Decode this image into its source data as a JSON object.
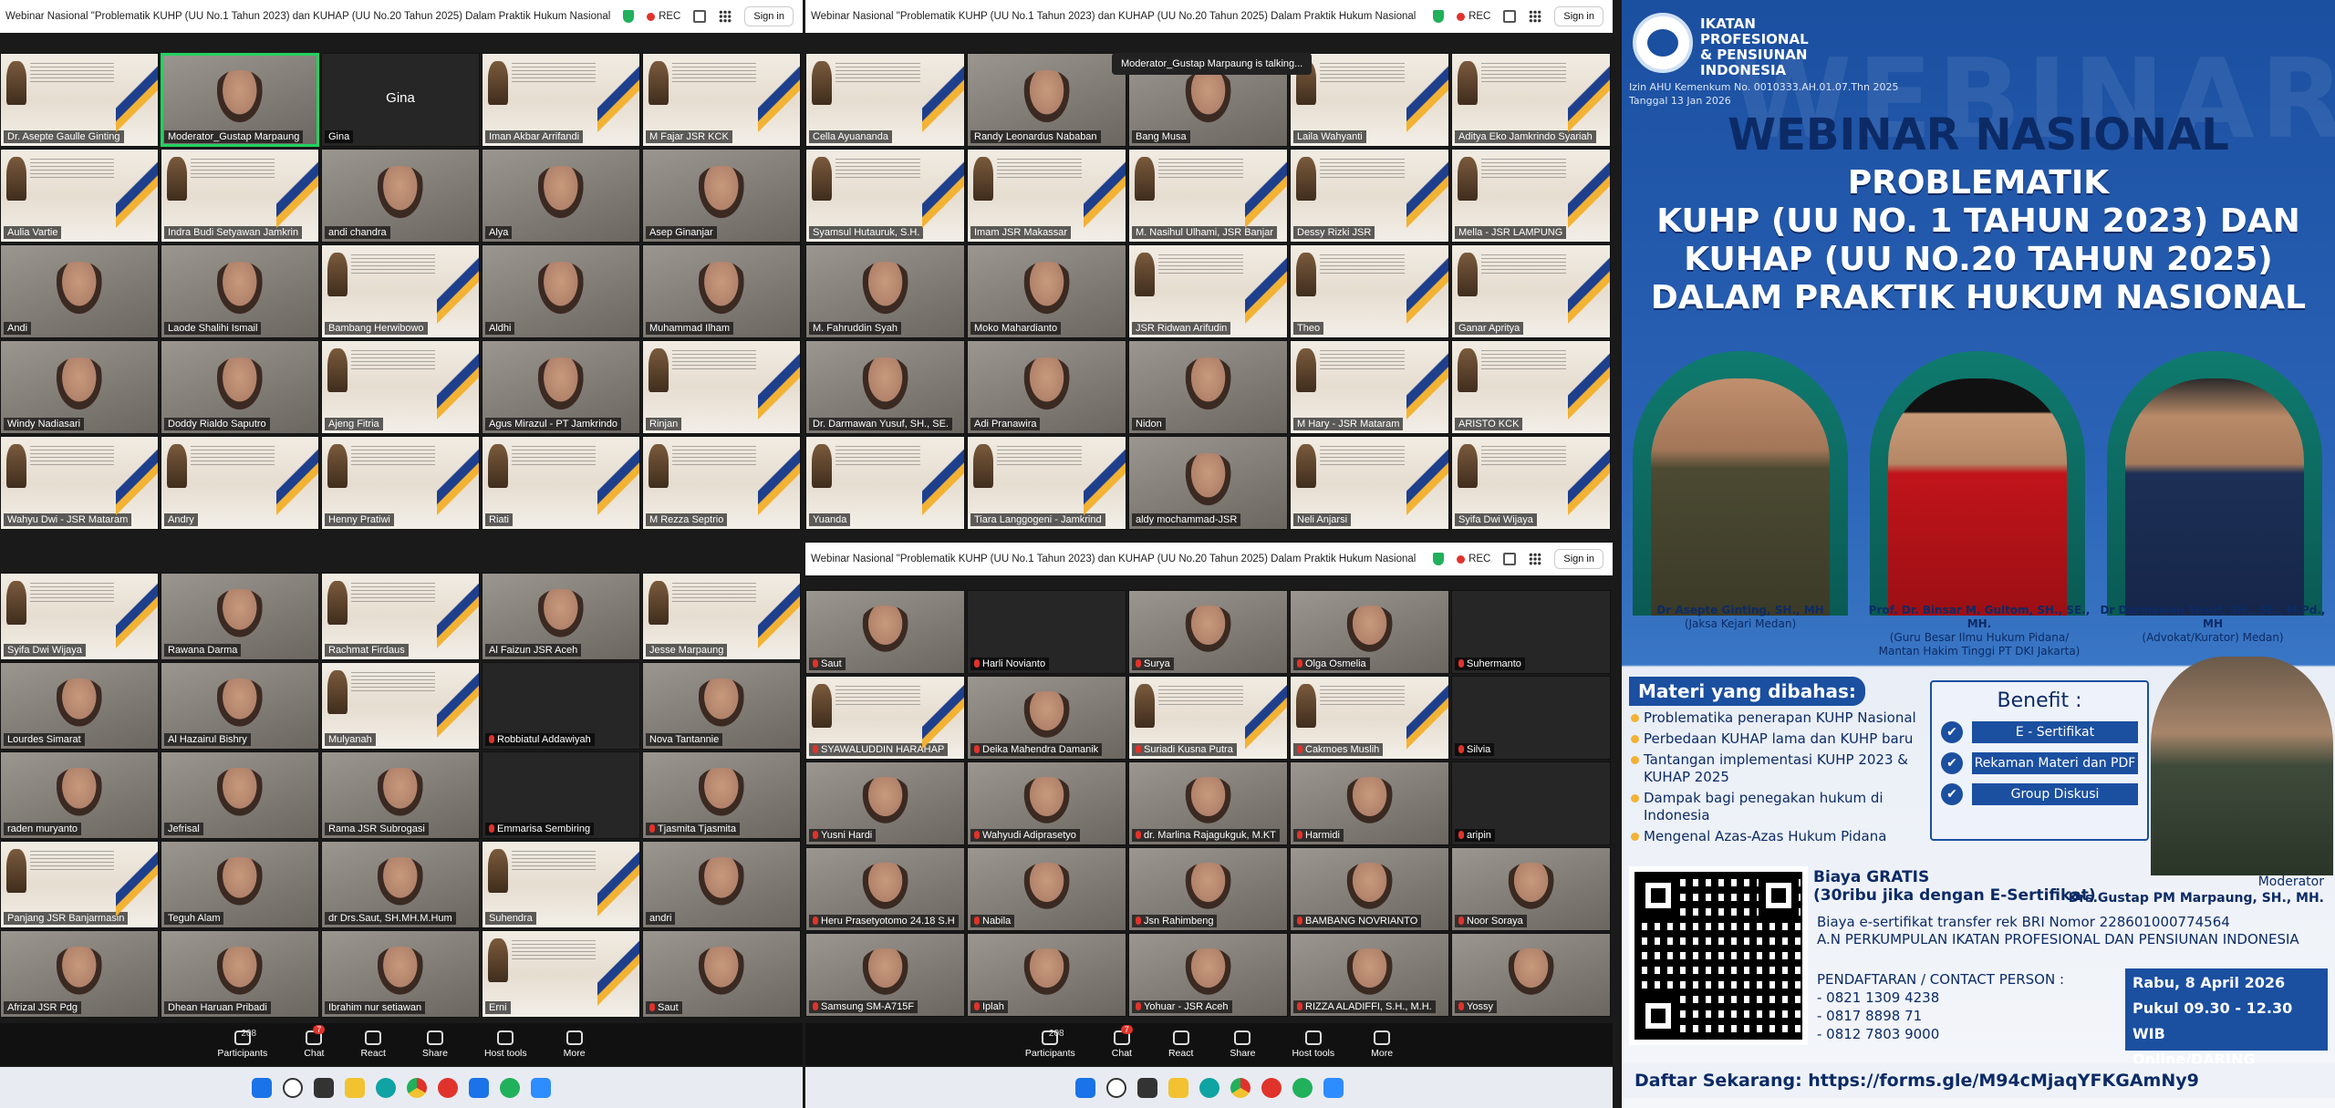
{
  "window_title": "Webinar Nasional \"Problematik KUHP (UU No.1 Tahun 2023) dan KUHAP (UU No.20 Tahun 2025) Dalam Praktik Hukum Nasional",
  "rec_label": "REC",
  "signin_label": "Sign in",
  "talking_tip": "Moderator_Gustap Marpaung is talking...",
  "active_name": "Gina",
  "controls": {
    "participants": "Participants",
    "participants_count": "208",
    "chat": "Chat",
    "chat_badge": "7",
    "react": "React",
    "share": "Share",
    "host_tools": "Host tools",
    "more": "More"
  },
  "win1_names": [
    "Dr. Asepte Gaulle Ginting",
    "Moderator_Gustap Marpaung",
    "Gina",
    "Iman Akbar Arrifandi",
    "M Fajar JSR KCK",
    "Aulia Vartie",
    "Indra Budi Setyawan Jamkrin",
    "andi chandra",
    "Alya",
    "Asep Ginanjar",
    "Andi",
    "Laode Shalihi Ismail",
    "Bambang Herwibowo",
    "Aldhi",
    "Muhammad Ilham",
    "Windy Nadiasari",
    "Doddy Rialdo Saputro",
    "Ajeng Fitria",
    "Agus Mirazul - PT Jamkrindo",
    "Rinjan",
    "Wahyu Dwi - JSR Mataram",
    "Andry",
    "Henny Pratiwi",
    "Riati",
    "M Rezza Septrio"
  ],
  "win2_names": [
    "Cella Ayuananda",
    "Randy Leonardus Nababan",
    "Bang Musa",
    "Laila Wahyanti",
    "Aditya Eko Jamkrindo Syariah",
    "Syamsul Hutauruk, S.H.",
    "Imam JSR Makassar",
    "M. Nasihul Ulhami, JSR Banjar",
    "Dessy Rizki JSR",
    "Mella - JSR LAMPUNG",
    "M. Fahruddin Syah",
    "Moko Mahardianto",
    "JSR Ridwan Arifudin",
    "Theo",
    "Ganar Apritya",
    "Dr. Darmawan Yusuf, SH., SE.",
    "Adi Pranawira",
    "Nidon",
    "M Hary - JSR Mataram",
    "ARISTO KCK",
    "Yuanda",
    "Tiara Langgogeni - Jamkrind",
    "aldy mochammad-JSR",
    "Neli Anjarsi",
    "Syifa Dwi Wijaya"
  ],
  "win3_names": [
    "Syifa Dwi Wijaya",
    "Rawana Darma",
    "Rachmat Firdaus",
    "Al Faizun JSR Aceh",
    "Jesse Marpaung",
    "Lourdes Simarat",
    "Al Hazairul Bishry",
    "Mulyanah",
    "Robbiatul Addawiyah",
    "Nova Tantannie",
    "raden muryanto",
    "Jefrisal",
    "Rama JSR Subrogasi",
    "Emmarisa Sembiring",
    "Tjasmita Tjasmita",
    "Panjang JSR Banjarmasin",
    "Teguh Alam",
    "dr Drs.Saut, SH.MH.M.Hum",
    "Suhendra",
    "andri",
    "Afrizal JSR Pdg",
    "Dhean Haruan Pribadi",
    "Ibrahim nur setiawan",
    "Erni",
    "Saut"
  ],
  "win4_names": [
    "Saut",
    "Harli Novianto",
    "Surya",
    "Olga Osmelia",
    "Suhermanto",
    "SYAWALUDDIN HARAHAP",
    "Deika Mahendra Damanik",
    "Suriadi Kusna Putra",
    "Cakmoes Muslih",
    "Silvia",
    "Yusni Hardi",
    "Wahyudi Adiprasetyo",
    "dr. Marlina Rajagukguk, M.KT",
    "Harmidi",
    "aripin",
    "Heru Prasetyotomo 24.18 S.H",
    "Nabila",
    "Jsn Rahimbeng",
    "BAMBANG NOVRIANTO",
    "Noor Soraya",
    "Samsung SM-A715F",
    "Iplah",
    "Yohuar - JSR Aceh",
    "RIZZA ALADIFFI, S.H., M.H.",
    "Yossy"
  ],
  "poster": {
    "watermark": "WEBINAR",
    "org": [
      "IKATAN",
      "PROFESIONAL",
      "& PENSIUNAN",
      "INDONESIA"
    ],
    "izin1": "Izin AHU Kemenkum No. 0010333.AH.01.07.Thn 2025",
    "izin2": "Tanggal 13 Jan 2026",
    "h1": "WEBINAR NASIONAL",
    "h2a": "PROBLEMATIK",
    "h2b": "KUHP (UU NO. 1 TAHUN 2023) DAN",
    "h2c": "KUHAP (UU NO.20 TAHUN 2025)",
    "h2d": "DALAM PRAKTIK HUKUM NASIONAL",
    "speakers": [
      {
        "name": "Dr Asepte Ginting, SH., MH",
        "role": "(Jaksa Kejari Medan)",
        "role2": ""
      },
      {
        "name": "Prof. Dr. Binsar M. Gultom, SH., SE., MH.",
        "role": "(Guru Besar Ilmu Hukum Pidana/",
        "role2": "Mantan Hakim Tinggi PT DKI Jakarta)"
      },
      {
        "name": "Dr Darmawan Yusuf, SH., SE., M.Pd., MH",
        "role": "(Advokat/Kurator) Medan)",
        "role2": ""
      }
    ],
    "materi_title": "Materi yang dibahas:",
    "materi": [
      "Problematika penerapan KUHP Nasional",
      "Perbedaan KUHAP lama dan KUHP baru",
      "Tantangan implementasi KUHP 2023 & KUHAP 2025",
      "Dampak bagi penegakan hukum di Indonesia",
      "Mengenal Azas-Azas Hukum Pidana"
    ],
    "benefit_title": "Benefit :",
    "benefits": [
      "E - Sertifikat",
      "Rekaman Materi dan PDF",
      "Group Diskusi"
    ],
    "biaya1": "Biaya GRATIS",
    "biaya2": "(30ribu jika dengan E-Sertifikat)",
    "mod_label": "Moderator",
    "mod_name": "Drs.Gustap PM Marpaung, SH., MH.",
    "transfer1": "Biaya e-sertifikat transfer rek BRI Nomor 228601000774564",
    "transfer2": "A.N PERKUMPULAN IKATAN PROFESIONAL DAN PENSIUNAN INDONESIA",
    "contact_title": "PENDAFTARAN / CONTACT PERSON :",
    "contacts": [
      "- 0821 1309 4238",
      "- 0817 8898 71",
      "- 0812 7803 9000"
    ],
    "date": "Rabu, 8 April 2026",
    "time": "Pukul 09.30 - 12.30 WIB",
    "mode": "Online/DARING",
    "daftar": "Daftar Sekarang: https://forms.gle/M94cMjaqYFKGAmNy9"
  },
  "colors": {
    "poster_blue": "#1b4fa0",
    "teal": "#0f7a6e",
    "gold": "#f2b233",
    "rec_red": "#e0332b",
    "active_green": "#23d160"
  }
}
